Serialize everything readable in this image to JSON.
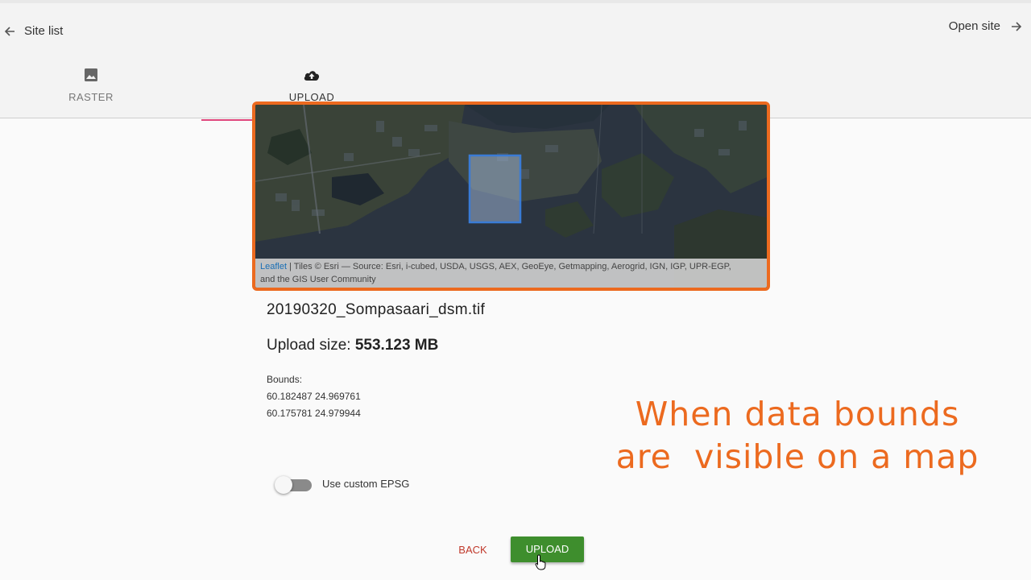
{
  "header": {
    "back_label": "Site list",
    "open_label": "Open site",
    "tabs": [
      {
        "label": "RASTER",
        "icon": "image-icon"
      },
      {
        "label": "UPLOAD",
        "icon": "cloud-upload-icon",
        "active": true
      }
    ]
  },
  "map": {
    "attribution_link": "Leaflet",
    "attribution_line1": " | Tiles © Esri — Source: Esri, i-cubed, USDA, USGS, AEX, GeoEye, Getmapping, Aerogrid, IGN, IGP, UPR-EGP,",
    "attribution_line2": "and the GIS User Community",
    "highlight_color": "#ec6a1f",
    "bounds_box_color": "#3a7bd5"
  },
  "file": {
    "name": "20190320_Sompasaari_dsm.tif",
    "size_label": "Upload size: ",
    "size_value": "553.123 MB",
    "bounds_label": "Bounds:",
    "bounds_line1": "60.182487 24.969761",
    "bounds_line2": "60.175781 24.979944"
  },
  "custom_epsg": {
    "label": "Use custom EPSG",
    "enabled": false
  },
  "overlay": {
    "line1": "When data bounds",
    "line2": "are  visible on a map"
  },
  "actions": {
    "back_label": "BACK",
    "upload_label": "UPLOAD"
  },
  "colors": {
    "accent_tab": "#e0467c",
    "upload_button": "#3e8e2d",
    "back_text": "#c0392b",
    "overlay_text": "#ec6a1f"
  }
}
